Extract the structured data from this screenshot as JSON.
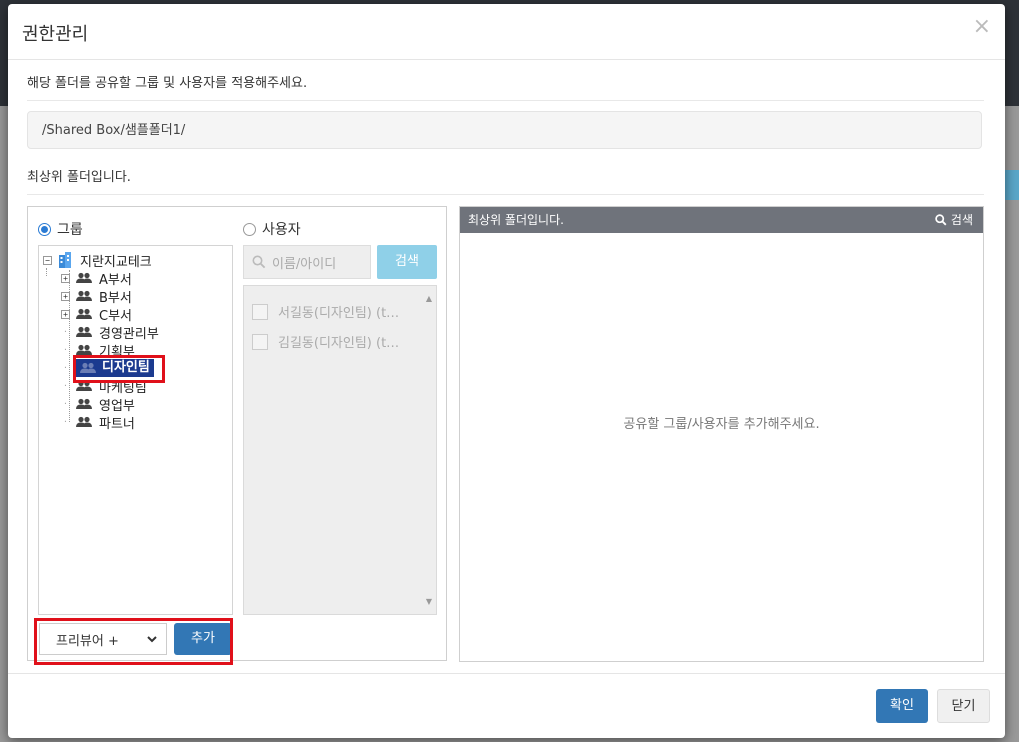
{
  "dialog": {
    "title": "권한관리",
    "close_glyph": "×",
    "info": "해당 폴더를 공유할 그룹 및 사용자를 적용해주세요.",
    "path": "/Shared Box/샘플폴더1/",
    "top_folder_msg": "최상위 폴더입니다."
  },
  "left": {
    "radio_group": "그룹",
    "radio_user": "사용자",
    "tree": {
      "root": "지란지교테크",
      "items": [
        {
          "label": "A부서",
          "expandable": true
        },
        {
          "label": "B부서",
          "expandable": true
        },
        {
          "label": "C부서",
          "expandable": true
        },
        {
          "label": "경영관리부",
          "expandable": false
        },
        {
          "label": "기획부",
          "expandable": false
        },
        {
          "label": "디자인팀",
          "expandable": false,
          "selected": true
        },
        {
          "label": "마케팅팀",
          "expandable": false
        },
        {
          "label": "영업부",
          "expandable": false
        },
        {
          "label": "파트너",
          "expandable": false
        }
      ]
    },
    "search_placeholder": "이름/아이디",
    "search_button": "검색",
    "users": [
      {
        "label": "서길동(디자인팀) (t…"
      },
      {
        "label": "김길동(디자인팀) (t…"
      }
    ],
    "permission_value": "프리뷰어 +",
    "add_button": "추가"
  },
  "right": {
    "header_title": "최상위 폴더입니다.",
    "header_search": "검색",
    "empty_message": "공유할 그룹/사용자를 추가해주세요."
  },
  "footer": {
    "confirm": "확인",
    "close": "닫기"
  },
  "colors": {
    "primary": "#3277b5",
    "search_btn": "#8fd0e8",
    "selected_bg": "#1b3a8f",
    "highlight": "#e0101a",
    "header_bar": "#6f737b"
  }
}
